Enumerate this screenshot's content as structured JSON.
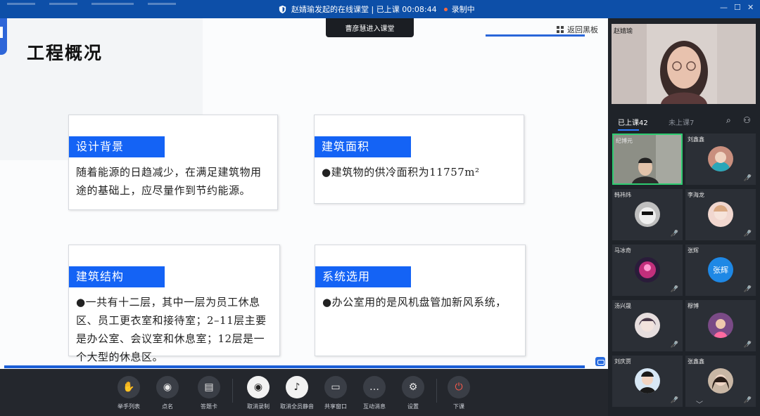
{
  "titlebar": {
    "title": "赵婧瑜发起的在线课堂 | 已上课 00:08:44",
    "recording": "录制中"
  },
  "toast": "曹彦慧进入课堂",
  "slide": {
    "title": "工程概况",
    "return_board": "返回黑板",
    "cards": [
      {
        "tag": "设计背景",
        "body": "随着能源的日趋减少，在满足建筑物用途的基础上，应尽量作到节约能源。"
      },
      {
        "tag": "建筑面积",
        "body": "●建筑物的供冷面积为11757m²"
      },
      {
        "tag": "建筑结构",
        "body": "●一共有十二层，其中一层为员工休息区、员工更衣室和接待室；2–11层主要是办公室、会议室和休息室；12层是一个大型的休息区。"
      },
      {
        "tag": "系统选用",
        "body": "●办公室用的是风机盘管加新风系统，"
      }
    ]
  },
  "toolbar": {
    "raise_hand": "举手列表",
    "roll_call": "点名",
    "answer_card": "答题卡",
    "cancel_record": "取消录制",
    "cancel_mute": "取消全员静音",
    "share_window": "共享窗口",
    "interact_msg": "互动消息",
    "settings": "设置",
    "end_class": "下课"
  },
  "panel": {
    "teacher_name": "赵婧瑜",
    "tab_in": "已上课42",
    "tab_out": "未上课7",
    "students": [
      "纪博元",
      "刘鑫鑫",
      "韩祎炜",
      "李海龙",
      "马冰奇",
      "张辉",
      "汤兴晟",
      "穆博",
      "刘庆贾",
      "张鑫鑫"
    ],
    "avatar_text": "张辉"
  },
  "colors": {
    "accent": "#1463f5",
    "titlebar": "#0d4fa8",
    "panel_bg": "#1f2329"
  }
}
